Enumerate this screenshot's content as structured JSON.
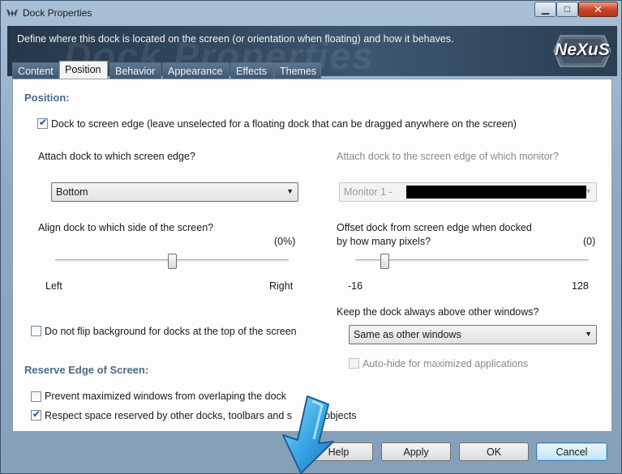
{
  "window": {
    "title": "Dock Properties"
  },
  "header": {
    "description": "Define where this dock is located on the screen (or orientation when floating) and how it behaves.",
    "watermark": "Dock Properties",
    "logo_text": "NeXuS"
  },
  "tabs": [
    {
      "label": "Content",
      "active": false
    },
    {
      "label": "Position",
      "active": true
    },
    {
      "label": "Behavior",
      "active": false
    },
    {
      "label": "Appearance",
      "active": false
    },
    {
      "label": "Effects",
      "active": false
    },
    {
      "label": "Themes",
      "active": false
    }
  ],
  "position": {
    "section_title": "Position:",
    "dock_to_edge": {
      "label": "Dock to screen edge (leave unselected for a floating dock that can be dragged anywhere on the screen)",
      "checked": true
    },
    "attach_edge": {
      "label": "Attach dock to which screen edge?",
      "value": "Bottom"
    },
    "attach_monitor": {
      "label": "Attach dock to the screen edge of which monitor?",
      "value": "Monitor 1 -"
    },
    "align": {
      "label": "Align dock to which side of the screen?",
      "value_text": "(0%)",
      "min_label": "Left",
      "max_label": "Right",
      "level": 0.5
    },
    "offset": {
      "label_line1": "Offset dock from screen edge when docked",
      "label_line2": "by how many pixels?",
      "value_text": "(0)",
      "min_label": "-16",
      "max_label": "128",
      "value": 0
    },
    "no_flip": {
      "label": "Do not flip background for docks at the top of the screen",
      "checked": false
    },
    "above": {
      "label": "Keep the dock always above other windows?",
      "value": "Same as other windows"
    },
    "autohide": {
      "label": "Auto-hide for maximized applications",
      "checked": false
    }
  },
  "reserve": {
    "section_title": "Reserve Edge of Screen:",
    "prevent": {
      "label": "Prevent maximized windows from overlaping the dock",
      "checked": false
    },
    "respect": {
      "label": "Respect space reserved by other docks, toolbars and s",
      "label_tail": "objects",
      "checked": true
    }
  },
  "buttons": {
    "help": "Help",
    "apply": "Apply",
    "ok": "OK",
    "cancel": "Cancel"
  },
  "colors": {
    "accent": "#4e6a86",
    "header_bg": "#2f4459",
    "arrow": "#3aa9e6"
  }
}
